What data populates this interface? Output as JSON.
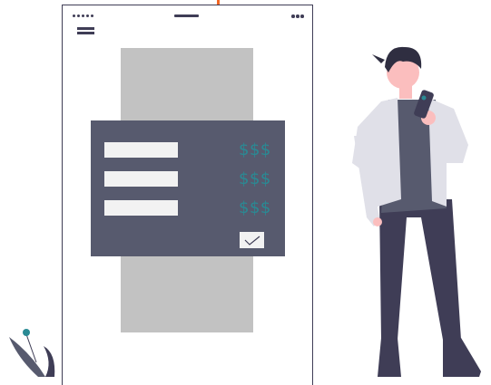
{
  "illustration": {
    "title": "",
    "rows": [
      {
        "price": "$$$"
      },
      {
        "price": "$$$"
      },
      {
        "price": "$$$"
      }
    ],
    "colors": {
      "dark": "#3f3d56",
      "panel": "#575a6e",
      "card": "#c2c2c2",
      "field": "#f2f2f2",
      "accent": "#2a8a94",
      "orange": "#f26522",
      "shirt": "#e0e0e8",
      "skin": "#fbbebe"
    },
    "icons": [
      "status-dots-icon",
      "more-icon",
      "menu-icon",
      "check-icon",
      "phone-icon"
    ]
  }
}
